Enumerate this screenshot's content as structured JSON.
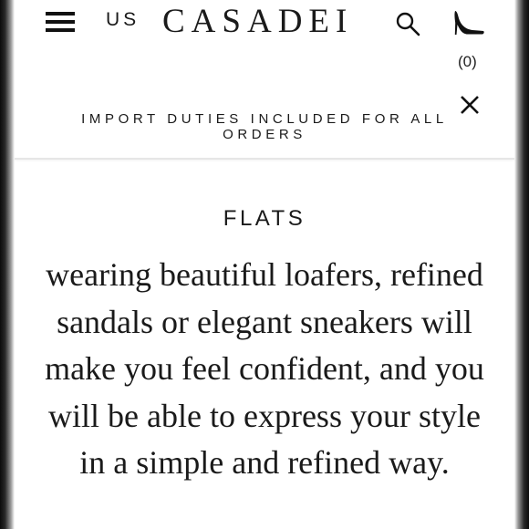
{
  "header": {
    "region_label": "US",
    "logo_text": "CASADEI",
    "cart_count": "(0)"
  },
  "announcement": {
    "text": "IMPORT DUTIES INCLUDED FOR ALL ORDERS"
  },
  "category": {
    "title": "FLATS",
    "description": "wearing beautiful loafers, refined sandals or elegant sneakers will make you feel confident, and you will be able to express your style in a simple and refined way."
  },
  "icons": {
    "menu": "hamburger-menu-icon",
    "search": "search-icon",
    "cart": "high-heel-shoe-icon",
    "close": "close-icon"
  },
  "colors": {
    "text": "#1a1a1a",
    "background": "#ffffff",
    "divider": "#e6e6e6"
  }
}
